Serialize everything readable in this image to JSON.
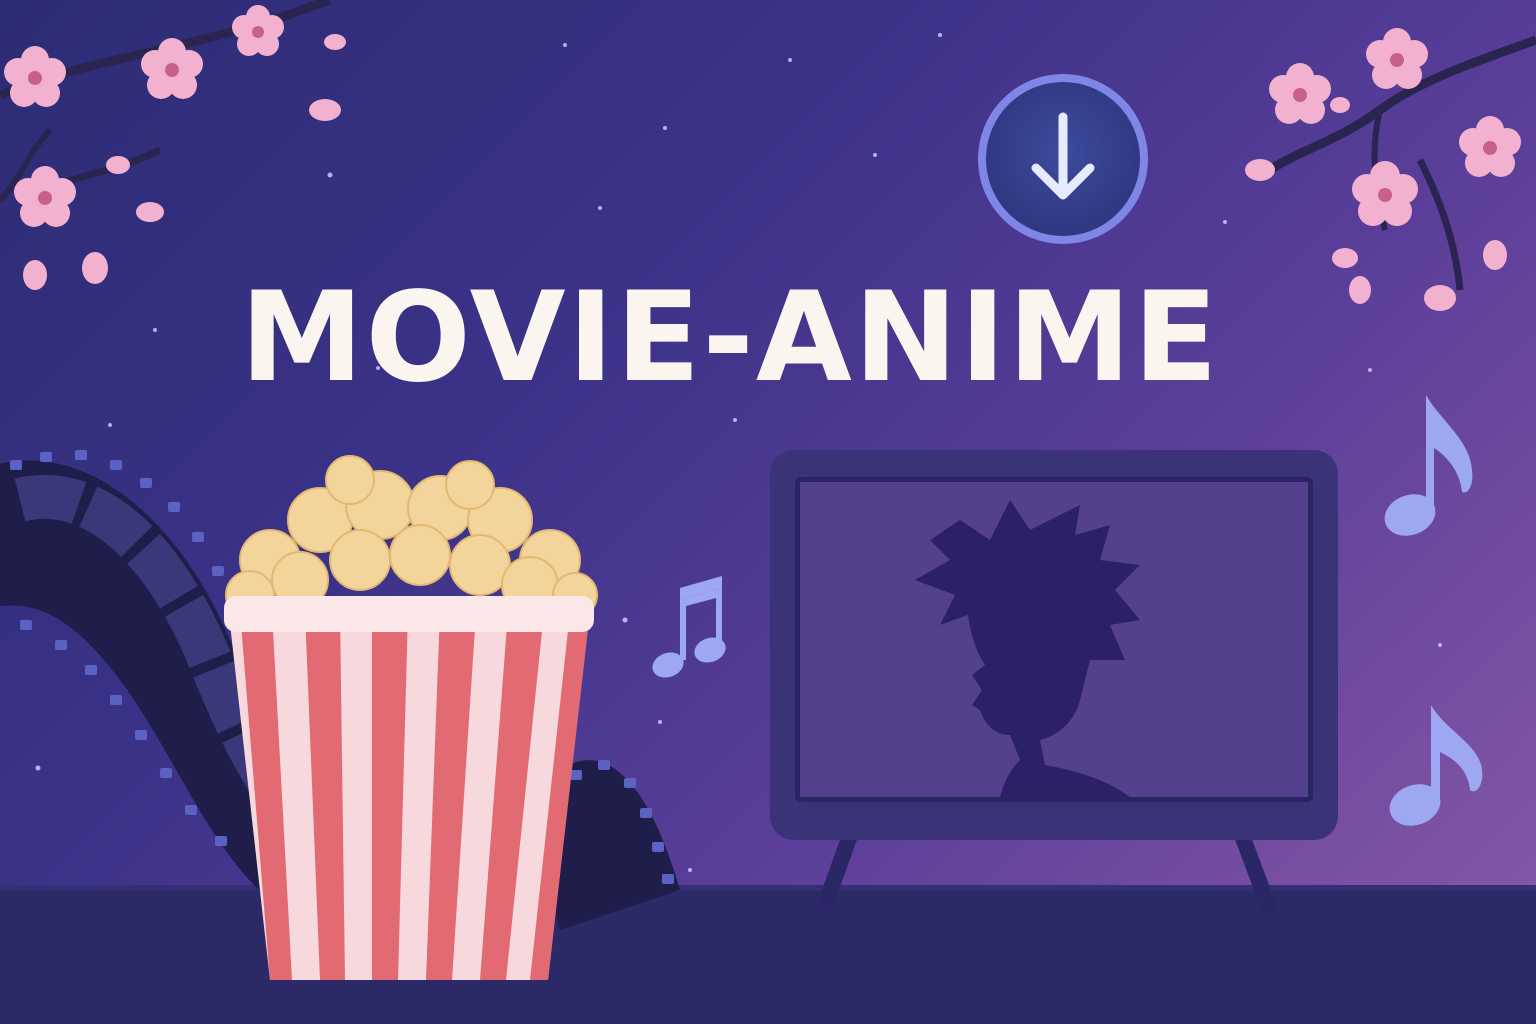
{
  "title": "MOVIE-ANIME",
  "icons": {
    "download": "download-arrow-icon",
    "popcorn": "popcorn-bucket-icon",
    "film_reel": "film-strip-icon",
    "television": "tv-icon",
    "character": "anime-character-silhouette",
    "music_notes": "music-note-icon",
    "blossoms": "cherry-blossom-icon"
  },
  "colors": {
    "background_start": "#2c2c74",
    "background_end": "#8a5aa8",
    "title_text": "#fbf5f0",
    "download_ring": "#7f86e6",
    "popcorn_stripe_red": "#e26a72",
    "popcorn_stripe_light": "#f7d8dc",
    "blossom": "#f2b1cf",
    "music_note": "#9ea8f2"
  }
}
